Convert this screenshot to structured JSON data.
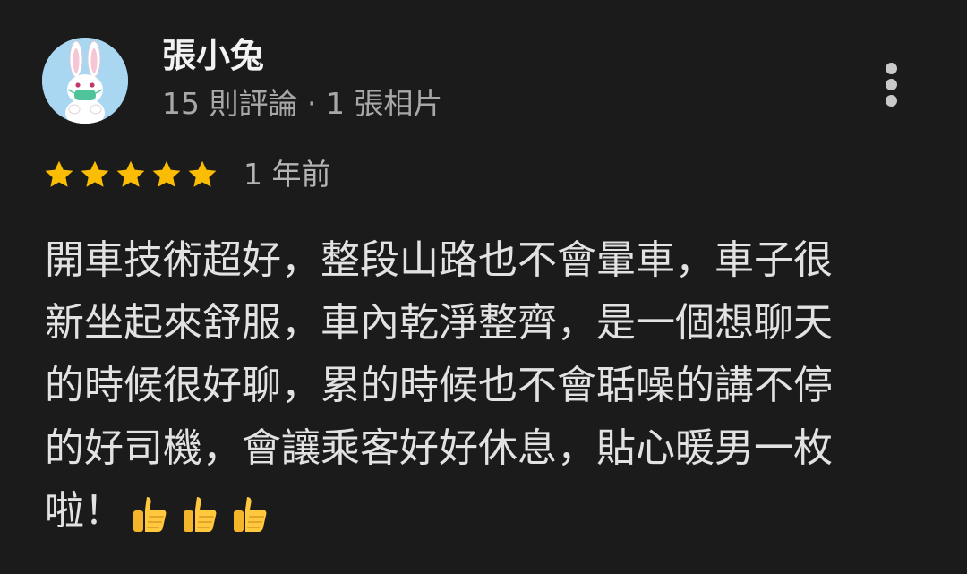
{
  "reviewer": {
    "name": "張小兔",
    "meta": "15 則評論 · 1 張相片"
  },
  "rating": {
    "stars": 5,
    "max": 5,
    "time": "1 年前"
  },
  "review": {
    "lines": [
      "開車技術超好，整段山路也不會暈車，車子很",
      "新坐起來舒服，車內乾淨整齊，是一個想聊天",
      "的時候很好聊，累的時候也不會聒噪的講不停",
      "的好司機，會讓乘客好好休息，貼心暖男一枚",
      "啦！"
    ],
    "emoji": [
      "thumbs-up",
      "thumbs-up",
      "thumbs-up"
    ]
  },
  "colors": {
    "background": "#1b1b1b",
    "star": "#fbbc04",
    "name": "#f2f2f2",
    "meta": "#a8a8a8",
    "body": "#e2e2e2"
  },
  "icons": {
    "avatar": "rabbit-with-mask-avatar",
    "menu": "more-vertical-icon",
    "star": "star-icon",
    "emoji": "thumbs-up-icon"
  }
}
